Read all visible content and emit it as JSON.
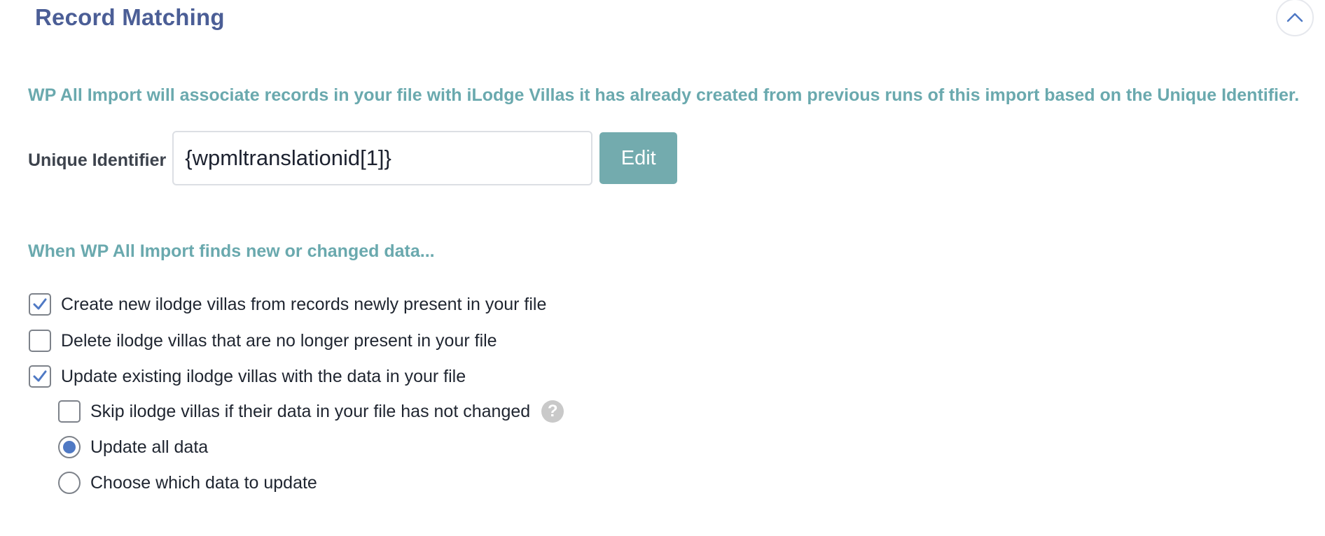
{
  "panel": {
    "title": "Record Matching",
    "collapse_icon": "chevron-up-icon"
  },
  "info_text": "WP All Import will associate records in your file with iLodge Villas it has already created from previous runs of this import based on the Unique Identifier.",
  "unique_identifier": {
    "label": "Unique Identifier",
    "value": "{wpmltranslationid[1]}",
    "edit_label": "Edit"
  },
  "section_heading": "When WP All Import finds new or changed data...",
  "options": {
    "create_new": {
      "label": "Create new ilodge villas from records newly present in your file",
      "checked": true
    },
    "delete_missing": {
      "label": "Delete ilodge villas that are no longer present in your file",
      "checked": false
    },
    "update_existing": {
      "label": "Update existing ilodge villas with the data in your file",
      "checked": true
    },
    "skip_unchanged": {
      "label": "Skip ilodge villas if their data in your file has not changed",
      "checked": false,
      "help_icon": "question-icon",
      "help_glyph": "?"
    }
  },
  "update_mode": {
    "selected": "all",
    "all_label": "Update all data",
    "choose_label": "Choose which data to update"
  },
  "colors": {
    "title": "#4b5e96",
    "accent_teal": "#6aa9ae",
    "edit_button": "#73abae",
    "check_blue": "#4f79c4"
  }
}
